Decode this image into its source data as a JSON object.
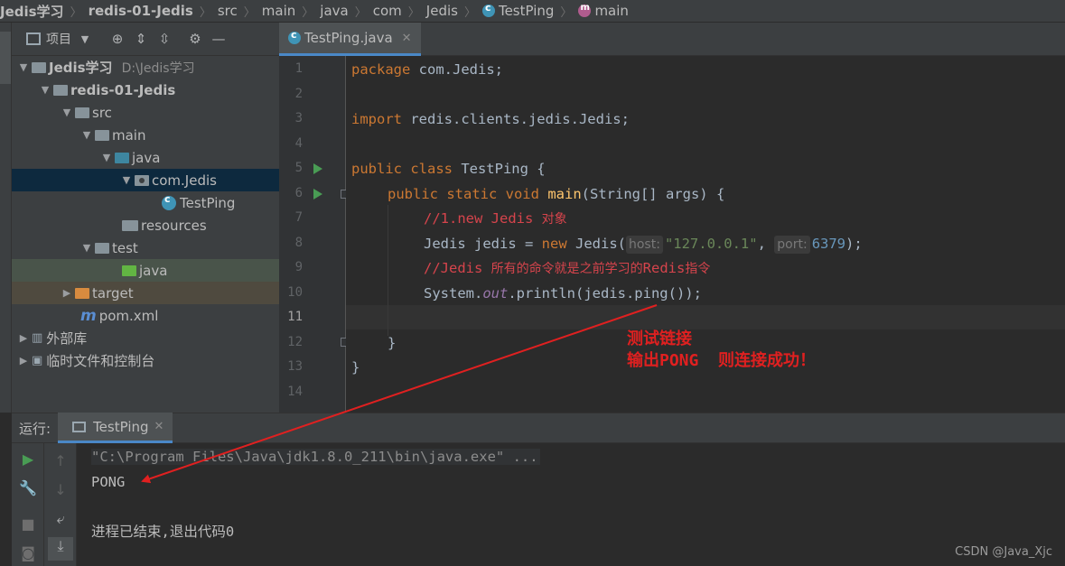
{
  "breadcrumb": {
    "items": [
      "Jedis学习",
      "redis-01-Jedis",
      "src",
      "main",
      "java",
      "com",
      "Jedis",
      "TestPing",
      "main"
    ]
  },
  "project_panel": {
    "title": "项目",
    "tree": {
      "root_label": "Jedis学习",
      "root_path": "D:\\Jedis学习",
      "module": "redis-01-Jedis",
      "src": "src",
      "main": "main",
      "java": "java",
      "package": "com.Jedis",
      "class": "TestPing",
      "resources": "resources",
      "test": "test",
      "test_java": "java",
      "target": "target",
      "pom": "pom.xml",
      "external_libs": "外部库",
      "scratches": "临时文件和控制台"
    }
  },
  "editor": {
    "tab_label": "TestPing.java",
    "line_numbers": [
      "1",
      "2",
      "3",
      "4",
      "5",
      "6",
      "7",
      "8",
      "9",
      "10",
      "11",
      "12",
      "13",
      "14"
    ],
    "current_line": 11,
    "code": {
      "l1_kw": "package",
      "l1_rest": " com.Jedis;",
      "l3_kw": "import",
      "l3_rest": " redis.clients.jedis.Jedis;",
      "l5_kw": "public class",
      "l5_rest": " TestPing {",
      "l6_kw": "public static void",
      "l6_fn": "main",
      "l6_rest": "(String[] args) {",
      "l7_cmt_a": "//1.new Jedis ",
      "l7_cmt_b": "对象",
      "l8_a": "Jedis jedis = ",
      "l8_kw": "new",
      "l8_b": " Jedis(",
      "l8_hint_host": "host:",
      "l8_str": "\"127.0.0.1\"",
      "l8_c": ", ",
      "l8_hint_port": "port:",
      "l8_num": "6379",
      "l8_d": ");",
      "l9_cmt_a": "//Jedis ",
      "l9_cmt_b": "所有的命令就是之前学习的",
      "l9_cmt_c": "Redis",
      "l9_cmt_d": "指令",
      "l10_a": "System.",
      "l10_out": "out",
      "l10_b": ".println(jedis.ping());",
      "l12": "}",
      "l13": "}"
    },
    "annotation": "测试链接\n输出PONG  则连接成功！"
  },
  "run_panel": {
    "label": "运行:",
    "tab_label": "TestPing",
    "console": {
      "cmd": "\"C:\\Program Files\\Java\\jdk1.8.0_211\\bin\\java.exe\" ...",
      "output": "PONG",
      "exit": "进程已结束,退出代码0"
    }
  },
  "watermark": "CSDN @Java_Xjc",
  "colors": {
    "annotation": "#e02020",
    "keyword": "#cc7832",
    "string": "#6a8759",
    "number": "#6897bb"
  }
}
